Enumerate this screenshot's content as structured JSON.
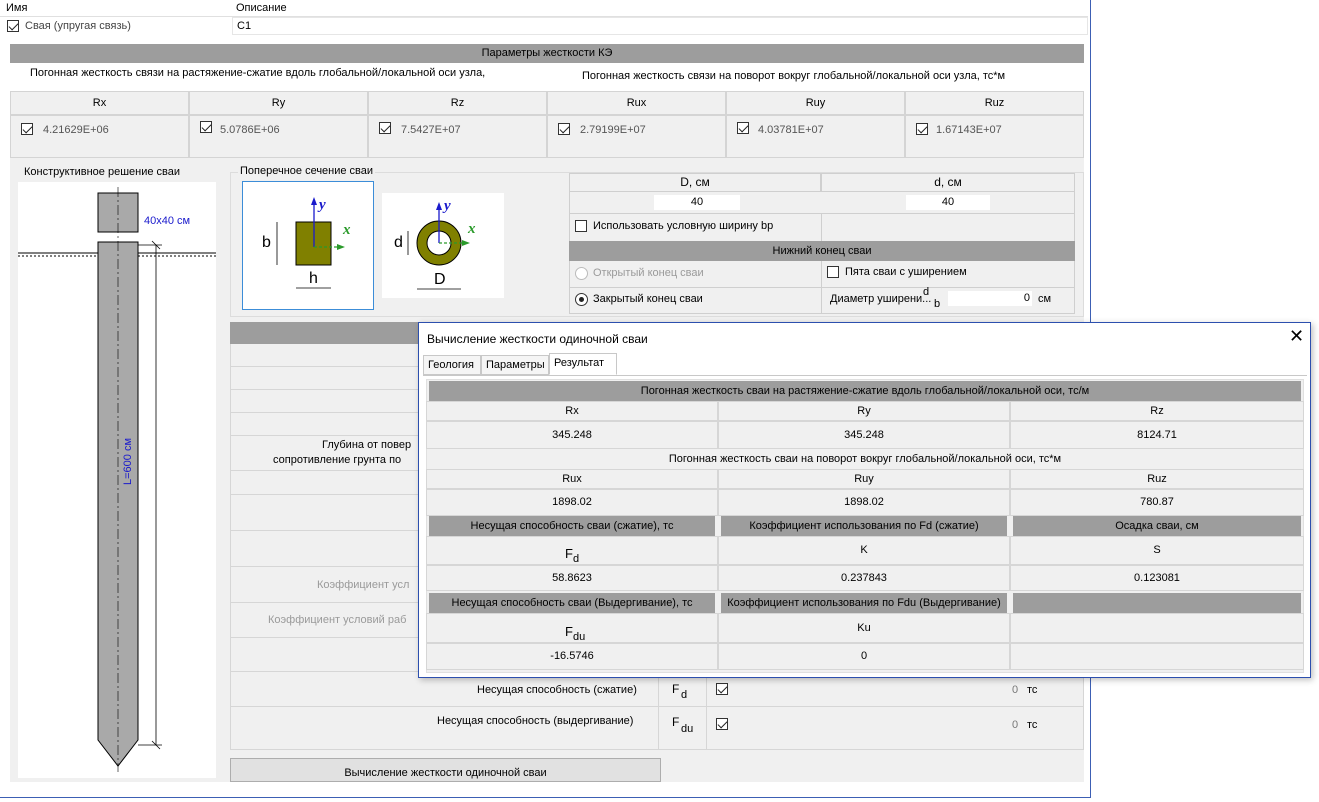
{
  "top": {
    "name_label": "Имя",
    "desc_label": "Описание",
    "element_name": "Свая (упругая связь)",
    "description": "С1"
  },
  "stiffness": {
    "title": "Параметры жесткости КЭ",
    "linear_label": "Погонная жесткость связи на растяжение-сжатие вдоль глобальной/локальной оси узла,",
    "rot_label": "Погонная жесткость связи на поворот вокруг глобальной/локальной оси узла, тс*м",
    "cols": [
      {
        "name": "Rx",
        "value": "4.21629E+06"
      },
      {
        "name": "Ry",
        "value": "5.0786E+06"
      },
      {
        "name": "Rz",
        "value": "7.5427E+07"
      },
      {
        "name": "Rux",
        "value": "2.79199E+07"
      },
      {
        "name": "Ruy",
        "value": "4.03781E+07"
      },
      {
        "name": "Ruz",
        "value": "1.67143E+07"
      }
    ]
  },
  "pile": {
    "title": "Конструктивное решение сваи",
    "section_size": "40x40 см",
    "length": "L=600 см"
  },
  "section": {
    "title": "Поперечное сечение сваи",
    "sq": {
      "b": "b",
      "h": "h",
      "y": "y",
      "x": "x"
    },
    "ring": {
      "d": "d",
      "D": "D",
      "y": "y",
      "x": "x"
    },
    "D_header": "D, см",
    "d_header": "d, см",
    "D_value": "40",
    "d_value": "40",
    "use_bp": "Использовать условную ширину bp",
    "lower_end": "Нижний конец сваи",
    "open_end": "Открытый конец сваи",
    "widened": "Пята сваи с уширением",
    "closed_end": "Закрытый конец сваи",
    "diam_label": "Диаметр уширени...",
    "db_main": "d",
    "db_sub": "b",
    "diam_value": "0",
    "diam_unit": "см"
  },
  "lower": {
    "depth1": "Глубина от повер",
    "depth2": "сопротивление грунта по",
    "coef1": "Коэффициент усл",
    "coef2": "Коэффициент условий раб",
    "bearing_comp": "Несущая способность (сжатие)",
    "bearing_pull": "Несущая способность (выдергивание)",
    "fd_main": "F",
    "fd_sub": "d",
    "fdu_sub": "du",
    "fd_value": "0",
    "fdu_value": "0",
    "unit": "тс",
    "calc_button": "Вычисление жесткости одиночной сваи"
  },
  "dialog": {
    "title": "Вычисление жесткости одиночной сваи",
    "tabs": [
      "Геология",
      "Параметры",
      "Результат"
    ],
    "lin_header": "Погонная жесткость сваи на растяжение-сжатие вдоль глобальной/локальной оси, тс/м",
    "rx": "Rx",
    "ry": "Ry",
    "rz": "Rz",
    "rx_v": "345.248",
    "ry_v": "345.248",
    "rz_v": "8124.71",
    "rot_header": "Погонная жесткость сваи на поворот вокруг глобальной/локальной оси, тс*м",
    "rux": "Rux",
    "ruy": "Ruy",
    "ruz": "Ruz",
    "rux_v": "1898.02",
    "ruy_v": "1898.02",
    "ruz_v": "780.87",
    "fd_h": "Несущая способность сваи (сжатие), тс",
    "k_h": "Коэффициент использования по Fd (сжатие)",
    "s_h": "Осадка сваи, см",
    "fd_sym_main": "F",
    "fd_sym_sub": "d",
    "k_sym": "K",
    "s_sym": "S",
    "fd_v": "58.8623",
    "k_v": "0.237843",
    "s_v": "0.123081",
    "fdu_h": "Несущая способность сваи (Выдергивание), тс",
    "ku_h": "Коэффициент использования по Fdu (Выдергивание)",
    "fdu_sym_sub": "du",
    "ku_sym": "Ku",
    "fdu_v": "-16.5746",
    "ku_v": "0"
  },
  "colors": {
    "olive": "#808000",
    "header_gray": "#9d9d9d",
    "accent_blue": "#3c5fb4"
  }
}
